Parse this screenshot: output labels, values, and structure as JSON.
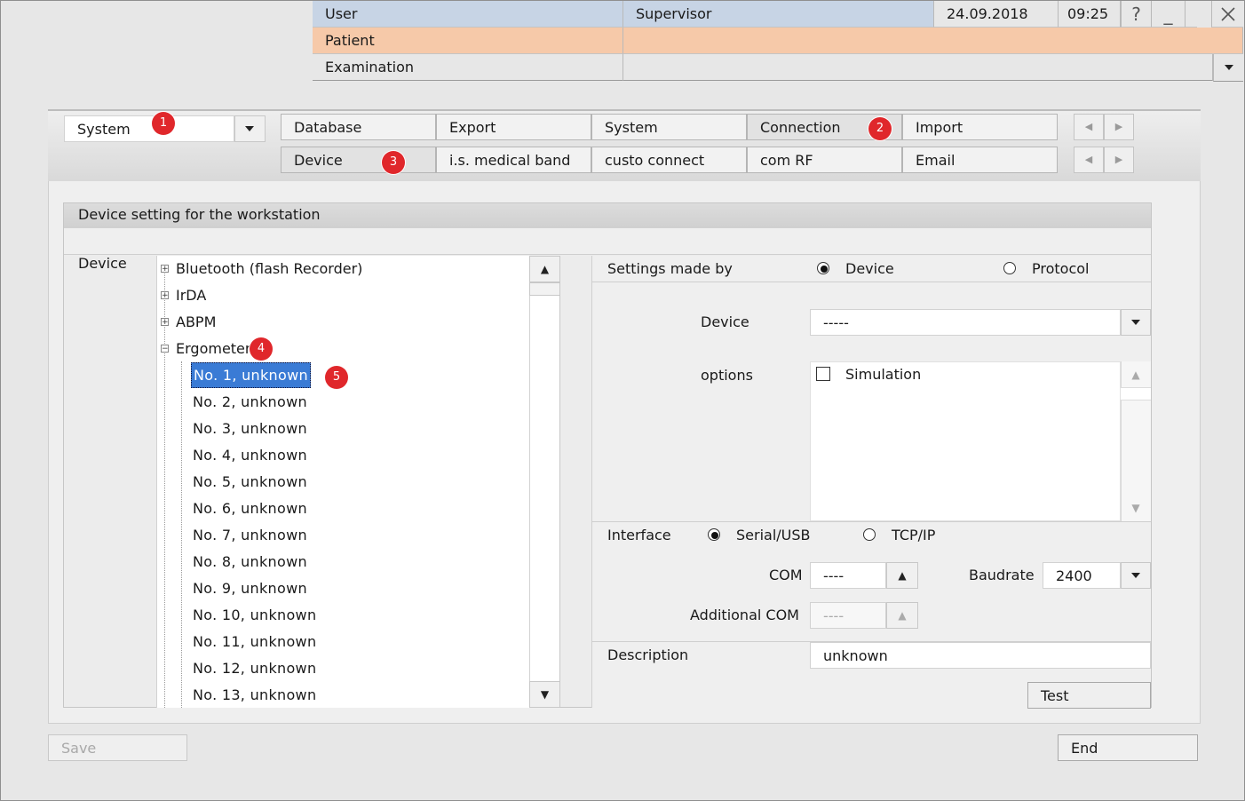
{
  "header": {
    "user_label": "User",
    "user_value": "Supervisor",
    "date": "24.09.2018",
    "time": "09:25",
    "help": "?",
    "minimize": "_",
    "patient_label": "Patient",
    "examination_label": "Examination"
  },
  "category_select": {
    "value": "System"
  },
  "tabs_row1": [
    "Database",
    "Export",
    "System",
    "Connection",
    "Import"
  ],
  "tabs_row2": [
    "Device",
    "i.s. medical band",
    "custo connect",
    "com RF",
    "Email"
  ],
  "badges": [
    "1",
    "2",
    "3",
    "4",
    "5"
  ],
  "section": {
    "title": "Device setting for the workstation",
    "device_label": "Device"
  },
  "tree": {
    "groups": [
      "Bluetooth (flash Recorder)",
      "IrDA",
      "ABPM",
      "Ergometer"
    ],
    "children": [
      "No. 1,  unknown",
      "No. 2,  unknown",
      "No. 3,  unknown",
      "No. 4,  unknown",
      "No. 5,  unknown",
      "No. 6,  unknown",
      "No. 7,  unknown",
      "No. 8,  unknown",
      "No. 9,  unknown",
      "No. 10,  unknown",
      "No. 11,  unknown",
      "No. 12,  unknown",
      "No. 13,  unknown"
    ],
    "selected_index": 0
  },
  "settings": {
    "made_by_label": "Settings made by",
    "made_by_device": "Device",
    "made_by_protocol": "Protocol",
    "device_label": "Device",
    "device_value": "-----",
    "options_label": "options",
    "simulation_label": "Simulation",
    "interface_label": "Interface",
    "serial_label": "Serial/USB",
    "tcp_label": "TCP/IP",
    "com_label": "COM",
    "com_value": "----",
    "baudrate_label": "Baudrate",
    "baudrate_value": "2400",
    "additional_com_label": "Additional COM",
    "additional_com_value": "----",
    "description_label": "Description",
    "description_value": "unknown",
    "test_button": "Test"
  },
  "footer": {
    "save": "Save",
    "end": "End"
  },
  "colors": {
    "selection": "#3a7bd5",
    "badge": "#e0272b",
    "patient_bar": "#f6c9a9",
    "user_bar": "#c7d4e5"
  }
}
